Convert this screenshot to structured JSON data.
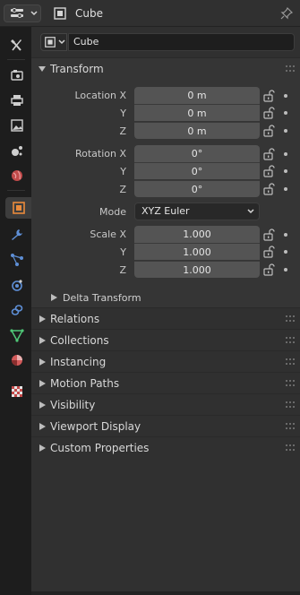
{
  "header": {
    "editor_type_icon": "properties-editor-icon",
    "object_icon": "object-icon",
    "title": "Cube",
    "pin_icon": "pin-icon"
  },
  "tabs": [
    {
      "name": "tool",
      "icon": "tool-wrench-screwdriver-icon"
    },
    {
      "name": "render",
      "icon": "render-camera-icon"
    },
    {
      "name": "output",
      "icon": "output-printer-icon"
    },
    {
      "name": "view-layer",
      "icon": "view-layer-image-icon"
    },
    {
      "name": "scene",
      "icon": "scene-icon"
    },
    {
      "name": "world",
      "icon": "world-globe-icon"
    },
    {
      "name": "object",
      "icon": "object-icon",
      "active": true
    },
    {
      "name": "modifiers",
      "icon": "modifier-wrench-icon"
    },
    {
      "name": "particles",
      "icon": "particles-icon"
    },
    {
      "name": "physics",
      "icon": "physics-icon"
    },
    {
      "name": "constraints",
      "icon": "constraints-icon"
    },
    {
      "name": "data",
      "icon": "mesh-data-icon"
    },
    {
      "name": "material",
      "icon": "material-sphere-icon"
    },
    {
      "name": "texture",
      "icon": "texture-checker-icon"
    }
  ],
  "object": {
    "name": "Cube"
  },
  "transform": {
    "title": "Transform",
    "location_label": "Location X",
    "y_label": "Y",
    "z_label": "Z",
    "location": [
      "0 m",
      "0 m",
      "0 m"
    ],
    "rotation_label": "Rotation X",
    "rotation": [
      "0°",
      "0°",
      "0°"
    ],
    "mode_label": "Mode",
    "mode_value": "XYZ Euler",
    "scale_label": "Scale X",
    "scale": [
      "1.000",
      "1.000",
      "1.000"
    ],
    "delta_title": "Delta Transform"
  },
  "panels": [
    "Relations",
    "Collections",
    "Instancing",
    "Motion Paths",
    "Visibility",
    "Viewport Display",
    "Custom Properties"
  ],
  "colors": {
    "active_object_orange": "#e98a3b",
    "modifier_blue": "#5e8fd6",
    "material_red": "#d25a5a",
    "data_green": "#4fc878"
  }
}
